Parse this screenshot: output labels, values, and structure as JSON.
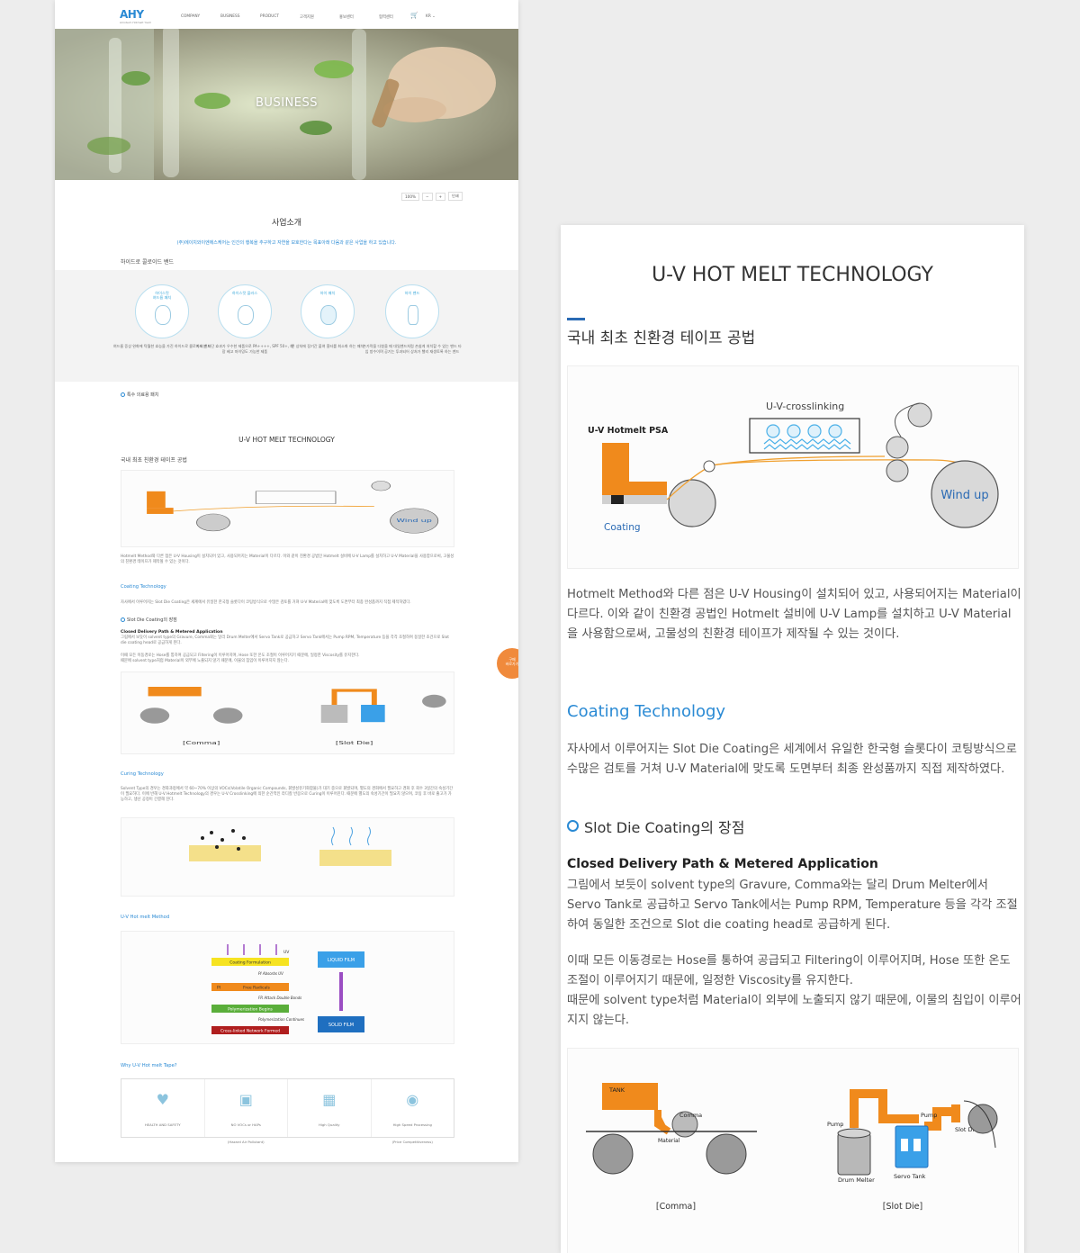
{
  "header": {
    "logo": "AHY",
    "logo_sub": "Amotech Hotmelt Yield",
    "nav": [
      "COMPANY",
      "BUSINESS",
      "PRODUCT",
      "고객지원",
      "홍보센터",
      "협력센터"
    ],
    "lang": "KR ⌄"
  },
  "hero": {
    "title": "BUSINESS"
  },
  "zoom_controls": {
    "level": "100%",
    "minus": "−",
    "plus": "+",
    "print": "인쇄"
  },
  "intro": {
    "title": "사업소개",
    "lead": "(주)에이치와이엔에스케어는 인간의 행복을 추구하고 자연을 보호한다는 목표아래 다음과 같은 사업을 하고 있습니다.",
    "band_heading": "하이드로 콜로이드 밴드"
  },
  "bands": [
    {
      "label": "하이스컷\n여드름 패치",
      "text": "여드름 증상 완화에 탁월한 효능을 가진 하이드로 콜로이드 밴드"
    },
    {
      "label": "하이스컷 플러스",
      "text": "자외선 차단 효과가 우수한 제품으로 PA++++, SPF 50+, 화장 베고 마이밍도 가능한 제품"
    },
    {
      "label": "하이 패치",
      "text": "큰 상처에 장기간 붙여 흉터를 최소화 하는 패치"
    },
    {
      "label": "하이 밴드",
      "text": "손가락을 다쳤을 때 대일밴드처럼 손쉽게 처치할 수 있는 밴드 타입 방수이며 공기는 투과되어 상처가 빨리 재생토록 하는 밴드"
    }
  ],
  "special": {
    "label": "특수 의료용 패치"
  },
  "uv": {
    "title": "U-V HOT MELT TECHNOLOGY",
    "sub": "국내 최초 친환경 테이프 공법",
    "fig1": {
      "crosslink": "U-V-crosslinking",
      "hotmelt": "U-V Hotmelt PSA",
      "coating": "Coating",
      "windup": "Wind up"
    },
    "para1": "Hotmelt Method와 다른 점은 U-V Housing이 설치되어 있고, 사용되어지는 Material이 다르다. 이와 같이 친환경 공법인 Hotmelt 설비에 U-V Lamp를 설치하고 U-V Material을 사용함으로써, 고물성의 친환경 테이프가 제작될 수 있는 것이다.",
    "coating_title": "Coating Technology",
    "coating_text": "자사에서 이루어지는 Slot Die Coating은 세계에서 유일한 한국형 슬롯다이 코팅방식으로 수많은 검토를 거쳐 U-V Material에 맞도록 도면부터 최종 완성품까지 직접 제작하였다.",
    "slot_title": "Slot Die Coating의 장점",
    "cdp_title": "Closed Delivery Path & Metered Application",
    "cdp_text": "그림에서 보듯이 solvent type의 Gravure, Comma와는 달리 Drum Melter에서 Servo Tank로 공급하고 Servo Tank에서는 Pump RPM, Temperature 등을 각각 조절하여 동일한 조건으로 Slot die coating head로 공급하게 된다.",
    "hose_text": "이때 모든 이동경로는 Hose를 통하여 공급되고 Filtering이 이루어지며, Hose 또한 온도 조절이 이루어지기 때문에, 일정한 Viscosity를 유지한다.",
    "solvent_text": "때문에 solvent type처럼 Material이 외부에 노출되지 않기 때문에, 이물의 침입이 이루어지지 않는다.",
    "fig2": {
      "tank": "TANK",
      "comma": "Comma",
      "material": "Material",
      "pump": "Pump",
      "drum": "Drum Melter",
      "servo": "Servo Tank",
      "slot": "Slot\nDie",
      "cap_comma": "[Comma]",
      "cap_slot": "[Slot Die]"
    },
    "curing_title": "Curing Technology",
    "curing_text": "Solvent Type의 경우는 경화과정에서 약 60~70% 이상의 VOCs(Volatile Organic Compounds, 휘발성유기화합물)가 대기 중으로 휘발되며, 별도의 경화에서 필요하고 경화 후 회수 3일간의 숙성기간이 필요하다. 이에 반해 U-V Hotmelt Technology의 경우는 U-V Crosslinking에 의한 순간적인 라디칼 반응으로 Curing이 이루어진다. 때문에 별도의 숙성기간이 필요치 않으며, 코팅 후 바로 출고가 가능하고, 생산 공정이 간결해 진다.",
    "method_title": "U-V Hot melt Method",
    "method": {
      "uv": "UV",
      "cf": "Coating Formulation",
      "pi_abs": "PI Absorbs UV",
      "pi": "PI",
      "fr": "Free Radicals",
      "fr_attack": "FR Attack Double Bonds",
      "pb": "Polymerization Begins",
      "pc": "Polymerization Continues",
      "cl": "Cross-linked Network Formed",
      "liquid": "LIQUID FILM",
      "solid": "SOLID FILM"
    },
    "why_title": "Why U-V Hot melt Tape?",
    "why": [
      {
        "icon": "heart-pulse-icon",
        "label": "HEALTH AND SAFETY"
      },
      {
        "icon": "factory-icon",
        "label": "NO VOCs or HAPs\n(Hazard Air Pollutant)"
      },
      {
        "icon": "bar-chart-icon",
        "label": "High Quality"
      },
      {
        "icon": "conveyor-icon",
        "label": "High Speed Processing\n(Price Competitiveness)"
      }
    ]
  },
  "float_btn": "구매\n바로가기",
  "colors": {
    "accent": "#2a8ad4",
    "orange": "#f08a3c"
  }
}
